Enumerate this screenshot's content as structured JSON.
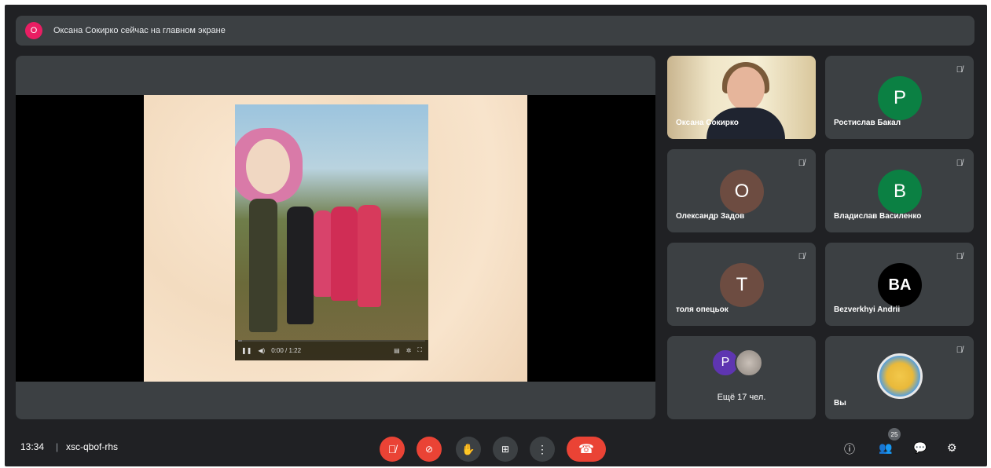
{
  "banner": {
    "avatar_letter": "O",
    "text": "Оксана Сокирко сейчас на главном экране"
  },
  "presentation": {
    "video_time": "0:00 / 1:22",
    "progress_fraction": 0.02
  },
  "participants": [
    {
      "name": "Оксана Сокирко",
      "type": "camera"
    },
    {
      "name": "Ростислав Бакал",
      "letter": "P",
      "color": "#0b8043",
      "muted": true
    },
    {
      "name": "Олександр Задов",
      "letter": "О",
      "color": "#6d4c41",
      "muted": true
    },
    {
      "name": "Владислав Василенко",
      "letter": "B",
      "color": "#0b8043",
      "muted": true
    },
    {
      "name": "толя опецьок",
      "letter": "T",
      "color": "#6d4c41",
      "muted": true
    },
    {
      "name": "Bezverkhyi Andrii",
      "letter": "BA",
      "color": "#000000",
      "muted": true
    },
    {
      "name": "Ещё 17 чел.",
      "letter": "P",
      "color": "#5e35b1"
    },
    {
      "name": "Вы",
      "type": "self",
      "muted": true
    }
  ],
  "bottom_bar": {
    "time": "13:34",
    "separator": "|",
    "meeting_code": "xsc-qbof-rhs",
    "participants_count": "25"
  },
  "icons": {
    "mic_off": "mic-off-icon",
    "camera_off": "camera-off-icon",
    "hand": "raise-hand-icon",
    "present": "present-screen-icon",
    "more": "more-options-icon",
    "hangup": "hang-up-icon",
    "info": "info-icon",
    "people": "people-icon",
    "chat": "chat-icon",
    "activities": "activities-icon"
  },
  "colors": {
    "background": "#202124",
    "surface": "#3c4043",
    "danger": "#ea4335"
  }
}
